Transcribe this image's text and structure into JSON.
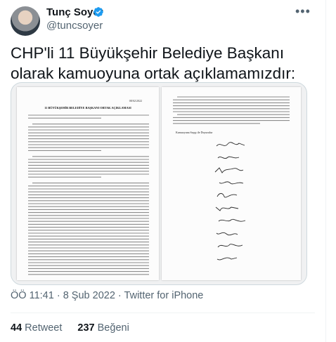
{
  "tweet": {
    "display_name": "Tunç Soyer",
    "handle": "@tuncsoyer",
    "text": "CHP'li 11 Büyükşehir Belediye Başkanı olarak kamuoyuna ortak açıklamamızdır:",
    "time": "ÖÖ 11:41",
    "date": "8 Şub 2022",
    "source": "Twitter for iPhone",
    "separator": "·",
    "more_icon": "more-horizontal-icon",
    "verified_icon": "verified-badge-icon"
  },
  "document": {
    "left_page": {
      "date": "08/02/2022",
      "heading": "11 BÜYÜKŞEHİR BELEDİYE BAŞKANI ORTAK AÇIKLAMASI"
    },
    "right_page": {
      "signatures_heading": "Kamuoyuna Saygı ile Duyurulur"
    }
  },
  "stats": {
    "retweets_count": "44",
    "retweets_label": "Retweet",
    "likes_count": "237",
    "likes_label": "Beğeni"
  },
  "colors": {
    "verified_blue": "#1d9bf0",
    "secondary_text": "#536471",
    "primary_text": "#0f1419"
  }
}
